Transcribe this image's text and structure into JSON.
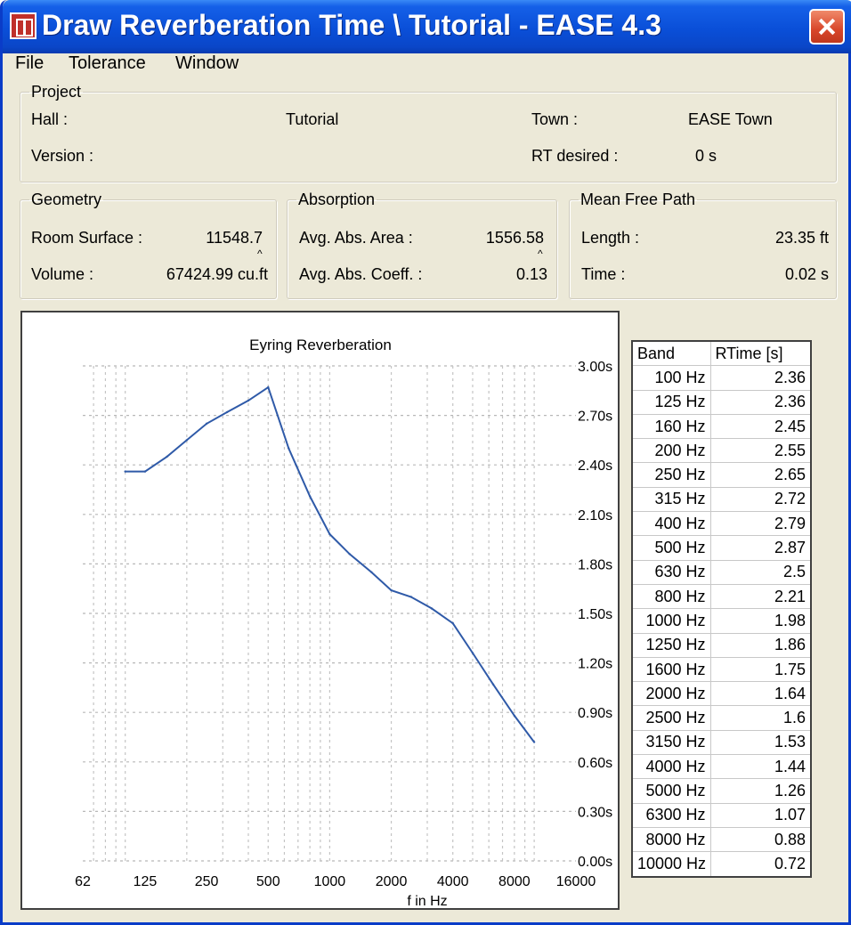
{
  "window": {
    "title": "Draw Reverberation Time \\ Tutorial - EASE 4.3",
    "icon": "ease-app-icon",
    "close_icon": "close-icon"
  },
  "menu": [
    "File",
    "Tolerance",
    "Window"
  ],
  "project": {
    "legend": "Project",
    "hall_label": "Hall :",
    "hall_value": "Tutorial",
    "town_label": "Town :",
    "town_value": "EASE Town",
    "version_label": "Version :",
    "version_value": "",
    "rt_desired_label": "RT desired :",
    "rt_desired_value": "0 s"
  },
  "geometry": {
    "legend": "Geometry",
    "surface_label": "Room Surface :",
    "surface_value": "11548.7",
    "surface_unit": "^",
    "volume_label": "Volume :",
    "volume_value": "67424.99 cu.ft"
  },
  "absorption": {
    "legend": "Absorption",
    "area_label": "Avg. Abs. Area :",
    "area_value": "1556.58",
    "area_unit": "^",
    "coeff_label": "Avg. Abs. Coeff. :",
    "coeff_value": "0.13"
  },
  "mean_free_path": {
    "legend": "Mean Free Path",
    "length_label": "Length :",
    "length_value": "23.35 ft",
    "time_label": "Time :",
    "time_value": "0.02 s"
  },
  "chart_data": {
    "type": "line",
    "title": "Eyring Reverberation",
    "xlabel": "f in Hz",
    "ylabel": "",
    "x_scale": "log",
    "x_ticks": [
      62,
      125,
      250,
      500,
      1000,
      2000,
      4000,
      8000,
      16000
    ],
    "x_tick_labels": [
      "62",
      "125",
      "250",
      "500",
      "1000",
      "2000",
      "4000",
      "8000",
      "16000"
    ],
    "xlim": [
      62,
      16000
    ],
    "y_ticks": [
      0,
      0.3,
      0.6,
      0.9,
      1.2,
      1.5,
      1.8,
      2.1,
      2.4,
      2.7,
      3.0
    ],
    "y_tick_labels": [
      "0.00s",
      "0.30s",
      "0.60s",
      "0.90s",
      "1.20s",
      "1.50s",
      "1.80s",
      "2.10s",
      "2.40s",
      "2.70s",
      "3.00s"
    ],
    "ylim": [
      0,
      3.0
    ],
    "y_axis_side": "right",
    "grid": true,
    "line_color": "#2f5aa8",
    "x": [
      100,
      125,
      160,
      200,
      250,
      315,
      400,
      500,
      630,
      800,
      1000,
      1250,
      1600,
      2000,
      2500,
      3150,
      4000,
      5000,
      6300,
      8000,
      10000
    ],
    "values": [
      2.36,
      2.36,
      2.45,
      2.55,
      2.65,
      2.72,
      2.79,
      2.87,
      2.5,
      2.21,
      1.98,
      1.86,
      1.75,
      1.64,
      1.6,
      1.53,
      1.44,
      1.26,
      1.07,
      0.88,
      0.72
    ]
  },
  "rt_table": {
    "headers": [
      "Band",
      "RTime [s]"
    ],
    "rows": [
      [
        "100 Hz",
        "2.36"
      ],
      [
        "125 Hz",
        "2.36"
      ],
      [
        "160 Hz",
        "2.45"
      ],
      [
        "200 Hz",
        "2.55"
      ],
      [
        "250 Hz",
        "2.65"
      ],
      [
        "315 Hz",
        "2.72"
      ],
      [
        "400 Hz",
        "2.79"
      ],
      [
        "500 Hz",
        "2.87"
      ],
      [
        "630 Hz",
        "2.5"
      ],
      [
        "800 Hz",
        "2.21"
      ],
      [
        "1000 Hz",
        "1.98"
      ],
      [
        "1250 Hz",
        "1.86"
      ],
      [
        "1600 Hz",
        "1.75"
      ],
      [
        "2000 Hz",
        "1.64"
      ],
      [
        "2500 Hz",
        "1.6"
      ],
      [
        "3150 Hz",
        "1.53"
      ],
      [
        "4000 Hz",
        "1.44"
      ],
      [
        "5000 Hz",
        "1.26"
      ],
      [
        "6300 Hz",
        "1.07"
      ],
      [
        "8000 Hz",
        "0.88"
      ],
      [
        "10000 Hz",
        "0.72"
      ]
    ]
  }
}
